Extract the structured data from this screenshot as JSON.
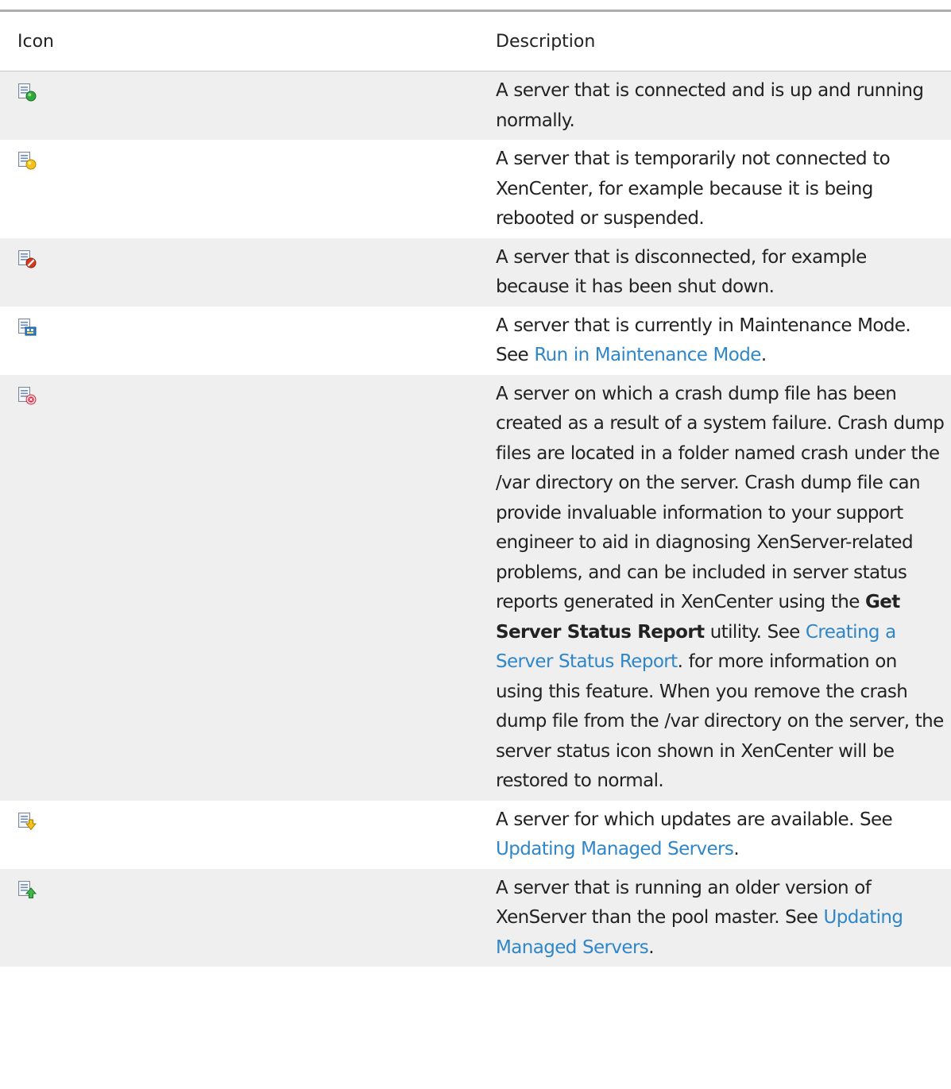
{
  "table": {
    "headers": {
      "icon": "Icon",
      "description": "Description"
    },
    "rows": [
      {
        "icon": "server-connected-icon",
        "parts": [
          {
            "t": "A server that is connected and is up and running normally."
          }
        ]
      },
      {
        "icon": "server-temporarily-disconnected-icon",
        "parts": [
          {
            "t": "A server that is temporarily not connected to XenCenter, for example because it is being rebooted or suspended."
          }
        ]
      },
      {
        "icon": "server-disconnected-icon",
        "parts": [
          {
            "t": "A server that is disconnected, for example because it has been shut down."
          }
        ]
      },
      {
        "icon": "server-maintenance-mode-icon",
        "parts": [
          {
            "t": "A server that is currently in Maintenance Mode. See "
          },
          {
            "t": "Run in Maintenance Mode",
            "link": true
          },
          {
            "t": "."
          }
        ]
      },
      {
        "icon": "server-crash-dump-icon",
        "parts": [
          {
            "t": "A server on which a crash dump file has been created as a result of a system failure. Crash dump files are located in a folder named crash under the /var directory on the server. Crash dump file can provide invaluable information to your support engineer to aid in diagnosing XenServer-related problems, and can be included in server status reports generated in XenCenter using the "
          },
          {
            "t": "Get Server Status Report",
            "bold": true
          },
          {
            "t": " utility. See "
          },
          {
            "t": "Creating a Server Status Report",
            "link": true
          },
          {
            "t": ". for more information on using this feature. When you remove the crash dump file from the /var directory on the server, the server status icon shown in XenCenter will be restored to normal."
          }
        ]
      },
      {
        "icon": "server-updates-available-icon",
        "parts": [
          {
            "t": "A server for which updates are available. See "
          },
          {
            "t": "Updating Managed Servers",
            "link": true
          },
          {
            "t": "."
          }
        ]
      },
      {
        "icon": "server-older-version-icon",
        "parts": [
          {
            "t": "A server that is running an older version of XenServer than the pool master. See "
          },
          {
            "t": "Updating Managed Servers",
            "link": true
          },
          {
            "t": "."
          }
        ]
      }
    ]
  }
}
